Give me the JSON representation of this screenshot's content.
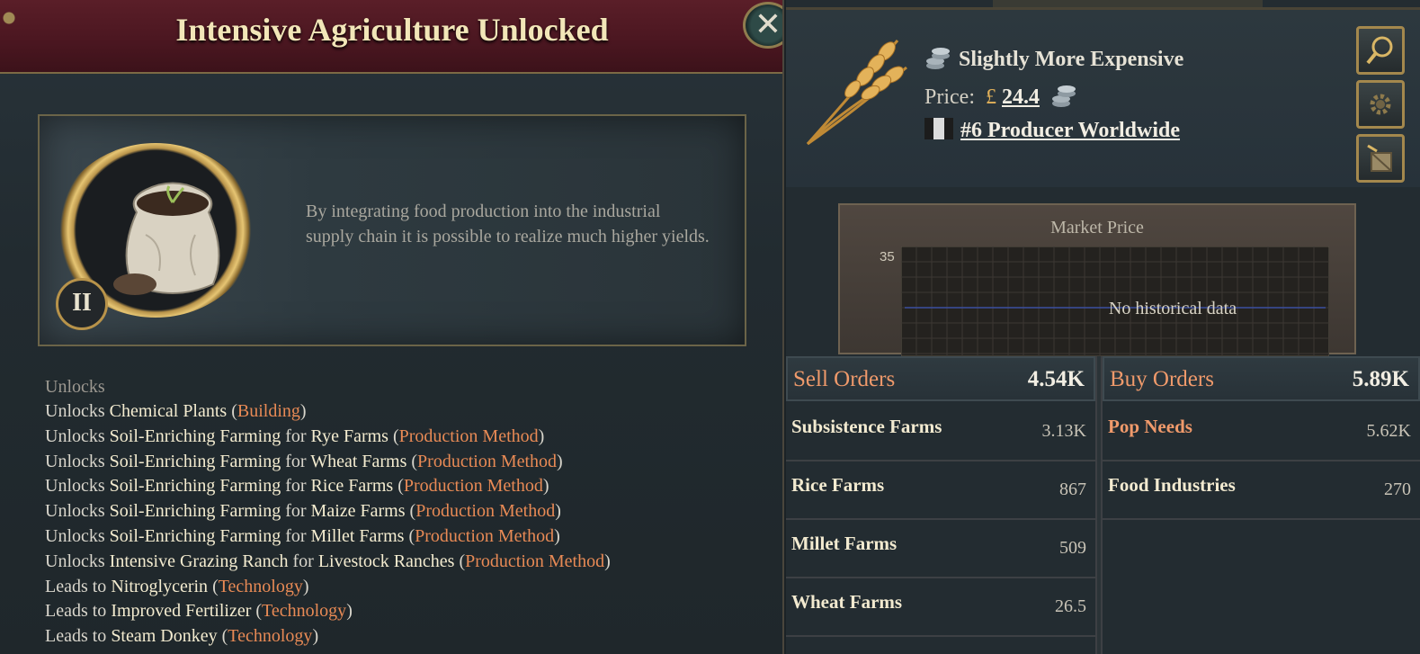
{
  "tech_popup": {
    "title": "Intensive Agriculture Unlocked",
    "tier": "II",
    "description": "By integrating food production into the industrial supply chain it is possible to realize much higher yields.",
    "unlocks_heading": "Unlocks",
    "unlock_lines": [
      {
        "verb": "Unlocks",
        "item": "Chemical Plants",
        "for_word": "",
        "target": "",
        "type": "Building"
      },
      {
        "verb": "Unlocks",
        "item": "Soil-Enriching Farming",
        "for_word": "for",
        "target": "Rye Farms",
        "type": "Production Method"
      },
      {
        "verb": "Unlocks",
        "item": "Soil-Enriching Farming",
        "for_word": "for",
        "target": "Wheat Farms",
        "type": "Production Method"
      },
      {
        "verb": "Unlocks",
        "item": "Soil-Enriching Farming",
        "for_word": "for",
        "target": "Rice Farms",
        "type": "Production Method"
      },
      {
        "verb": "Unlocks",
        "item": "Soil-Enriching Farming",
        "for_word": "for",
        "target": "Maize Farms",
        "type": "Production Method"
      },
      {
        "verb": "Unlocks",
        "item": "Soil-Enriching Farming",
        "for_word": "for",
        "target": "Millet Farms",
        "type": "Production Method"
      },
      {
        "verb": "Unlocks",
        "item": "Intensive Grazing Ranch",
        "for_word": "for",
        "target": "Livestock Ranches",
        "type": "Production Method"
      },
      {
        "verb": "Leads to",
        "item": "Nitroglycerin",
        "for_word": "",
        "target": "",
        "type": "Technology"
      },
      {
        "verb": "Leads to",
        "item": "Improved Fertilizer",
        "for_word": "",
        "target": "",
        "type": "Technology"
      },
      {
        "verb": "Leads to",
        "item": "Steam Donkey",
        "for_word": "",
        "target": "",
        "type": "Technology"
      }
    ]
  },
  "goods_panel": {
    "price_status": "Slightly More Expensive",
    "price_label": "Price:",
    "currency": "£",
    "price_value": "24.4",
    "rank_text": "#6 Producer Worldwide",
    "side_buttons": [
      "magnifier-icon",
      "gear-icon",
      "crate-icon"
    ],
    "chart": {
      "title": "Market Price",
      "y_tick": "35",
      "empty_message": "No historical data"
    },
    "sell_orders": {
      "label": "Sell Orders",
      "total": "4.54K",
      "rows": [
        {
          "name": "Subsistence Farms",
          "value": "3.13K"
        },
        {
          "name": "Rice Farms",
          "value": "867"
        },
        {
          "name": "Millet Farms",
          "value": "509"
        },
        {
          "name": "Wheat Farms",
          "value": "26.5"
        }
      ]
    },
    "buy_orders": {
      "label": "Buy Orders",
      "total": "5.89K",
      "rows": [
        {
          "name": "Pop Needs",
          "value": "5.62K",
          "highlight": true
        },
        {
          "name": "Food Industries",
          "value": "270",
          "highlight": false
        }
      ]
    }
  },
  "colors": {
    "header_maroon": "#4a1620",
    "gold_trim": "#b8934a",
    "accent_orange": "#e88a55",
    "title_cream": "#f2e6b8"
  }
}
